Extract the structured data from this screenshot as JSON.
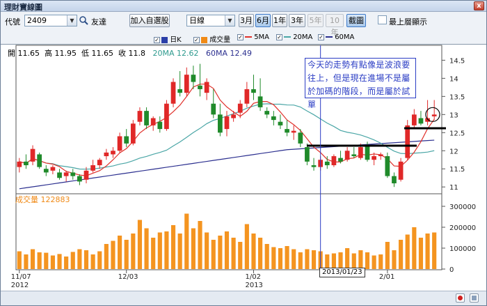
{
  "window": {
    "title": "理財寶線圖",
    "close_glyph": "x"
  },
  "toolbar": {
    "code_label": "代號",
    "code_value": "2409",
    "stock_name": "友達",
    "add_watchlist": "加入自選股",
    "chart_type": "日線",
    "ranges": [
      "3月",
      "6月",
      "1年",
      "3年",
      "5年",
      "10年"
    ],
    "active_range": "6月",
    "screenshot": "截圖",
    "topmost_label": "最上層顯示",
    "dropdown_glyph": "▼",
    "search_icon": "magnifier-icon"
  },
  "legend": {
    "items": [
      {
        "label": "日K",
        "color": "#2b3fa8",
        "kind": "box"
      },
      {
        "label": "成交量",
        "color": "#f08a16",
        "kind": "box"
      },
      {
        "label": "5MA",
        "color": "#e0302a",
        "kind": "line"
      },
      {
        "label": "20MA",
        "color": "#4aa6a6",
        "kind": "line"
      },
      {
        "label": "60MA",
        "color": "#2b2f8f",
        "kind": "line"
      }
    ],
    "check_glyph": "✓"
  },
  "ohlc": {
    "open_label": "開",
    "open": "11.65",
    "high_label": "高",
    "high": "11.95",
    "low_label": "低",
    "low": "11.65",
    "close_label": "收",
    "close": "11.8",
    "ma20_label": "20MA",
    "ma20": "12.62",
    "ma60_label": "60MA",
    "ma60": "12.49"
  },
  "note": "今天的走勢有點像是波浪要往上，但是現在進場不是屬於加碼的階段，而是屬於試單",
  "volume": {
    "label": "成交量",
    "value": "122883"
  },
  "cursor_date": "2013/01/23",
  "chart_data": {
    "type": "candlestick",
    "price_axis": {
      "ticks": [
        11,
        11.5,
        12,
        12.5,
        13,
        13.5,
        14,
        14.5
      ]
    },
    "volume_axis": {
      "ticks": [
        "0",
        "100000",
        "200000",
        "300000"
      ]
    },
    "x_ticks": [
      {
        "label": "11/07",
        "sub": "2012"
      },
      {
        "label": "12/03",
        "sub": ""
      },
      {
        "label": "1/02",
        "sub": "2013"
      },
      {
        "label": "2/01",
        "sub": ""
      }
    ],
    "candles": [
      [
        11.55,
        11.8,
        11.4,
        11.7,
        85000
      ],
      [
        11.7,
        11.9,
        11.5,
        11.6,
        70000
      ],
      [
        11.7,
        12.15,
        11.6,
        12.05,
        95000
      ],
      [
        11.9,
        11.95,
        11.5,
        11.55,
        80000
      ],
      [
        11.5,
        11.6,
        11.3,
        11.4,
        78000
      ],
      [
        11.45,
        11.6,
        11.35,
        11.55,
        65000
      ],
      [
        11.4,
        11.5,
        11.2,
        11.25,
        72000
      ],
      [
        11.3,
        11.45,
        11.15,
        11.4,
        60000
      ],
      [
        11.4,
        11.5,
        11.2,
        11.3,
        82000
      ],
      [
        11.3,
        11.35,
        11.05,
        11.15,
        95000
      ],
      [
        11.2,
        11.55,
        11.1,
        11.45,
        90000
      ],
      [
        11.45,
        11.75,
        11.4,
        11.6,
        70000
      ],
      [
        11.6,
        11.8,
        11.5,
        11.75,
        85000
      ],
      [
        11.85,
        12.05,
        11.75,
        11.95,
        120000
      ],
      [
        11.9,
        12.1,
        11.8,
        12.0,
        135000
      ],
      [
        12.0,
        12.5,
        11.95,
        12.4,
        160000
      ],
      [
        12.4,
        12.6,
        12.1,
        12.2,
        140000
      ],
      [
        12.2,
        12.85,
        12.15,
        12.75,
        170000
      ],
      [
        12.8,
        13.2,
        12.7,
        13.1,
        235000
      ],
      [
        13.1,
        13.2,
        12.6,
        12.7,
        195000
      ],
      [
        12.7,
        12.95,
        12.55,
        12.9,
        150000
      ],
      [
        12.8,
        12.95,
        12.5,
        12.6,
        175000
      ],
      [
        12.6,
        13.4,
        12.55,
        13.3,
        180000
      ],
      [
        13.3,
        14.0,
        13.2,
        13.9,
        210000
      ],
      [
        13.7,
        14.2,
        13.5,
        13.6,
        170000
      ],
      [
        13.6,
        14.3,
        13.5,
        14.1,
        265000
      ],
      [
        14.1,
        14.35,
        13.7,
        13.9,
        195000
      ],
      [
        13.8,
        14.4,
        13.5,
        13.7,
        230000
      ],
      [
        13.6,
        14.0,
        13.4,
        13.9,
        175000
      ],
      [
        13.3,
        13.7,
        12.9,
        13.0,
        140000
      ],
      [
        13.0,
        13.3,
        12.4,
        12.5,
        160000
      ],
      [
        12.6,
        13.1,
        12.4,
        12.95,
        180000
      ],
      [
        12.9,
        13.1,
        12.8,
        13.0,
        150000
      ],
      [
        13.05,
        13.4,
        12.9,
        13.3,
        130000
      ],
      [
        13.3,
        13.9,
        13.2,
        13.7,
        215000
      ],
      [
        13.7,
        14.1,
        13.4,
        13.6,
        170000
      ],
      [
        13.5,
        14.0,
        13.1,
        13.2,
        150000
      ],
      [
        13.1,
        13.2,
        12.9,
        13.0,
        120000
      ],
      [
        12.95,
        13.1,
        12.7,
        12.85,
        105000
      ],
      [
        12.8,
        13.0,
        12.6,
        12.7,
        100000
      ],
      [
        12.6,
        12.85,
        12.4,
        12.5,
        110000
      ],
      [
        12.5,
        12.7,
        12.3,
        12.55,
        95000
      ],
      [
        12.5,
        12.6,
        12.1,
        12.2,
        80000
      ],
      [
        12.1,
        12.2,
        11.6,
        11.7,
        95000
      ],
      [
        11.6,
        11.8,
        11.45,
        11.55,
        90000
      ],
      [
        11.55,
        11.85,
        11.45,
        11.75,
        85000
      ],
      [
        11.7,
        11.85,
        11.5,
        11.6,
        70000
      ],
      [
        11.6,
        11.9,
        11.55,
        11.85,
        75000
      ],
      [
        11.8,
        12.0,
        11.65,
        11.7,
        80000
      ],
      [
        11.75,
        12.1,
        11.7,
        12.0,
        100000
      ],
      [
        11.9,
        12.1,
        11.8,
        11.85,
        75000
      ],
      [
        11.8,
        12.2,
        11.75,
        12.1,
        90000
      ],
      [
        12.15,
        12.25,
        11.7,
        11.75,
        80000
      ],
      [
        11.75,
        11.95,
        11.6,
        11.85,
        65000
      ],
      [
        11.85,
        11.95,
        11.75,
        11.9,
        70000
      ],
      [
        11.85,
        11.95,
        11.25,
        11.3,
        130000
      ],
      [
        11.3,
        11.4,
        11.0,
        11.1,
        90000
      ],
      [
        11.2,
        11.8,
        11.15,
        11.7,
        140000
      ],
      [
        11.8,
        12.85,
        11.75,
        12.7,
        165000
      ],
      [
        12.7,
        13.15,
        12.6,
        13.0,
        200000
      ],
      [
        12.9,
        13.1,
        12.7,
        12.75,
        150000
      ],
      [
        12.8,
        13.4,
        12.7,
        12.9,
        170000
      ],
      [
        12.95,
        13.4,
        12.85,
        13.0,
        175000
      ]
    ]
  }
}
